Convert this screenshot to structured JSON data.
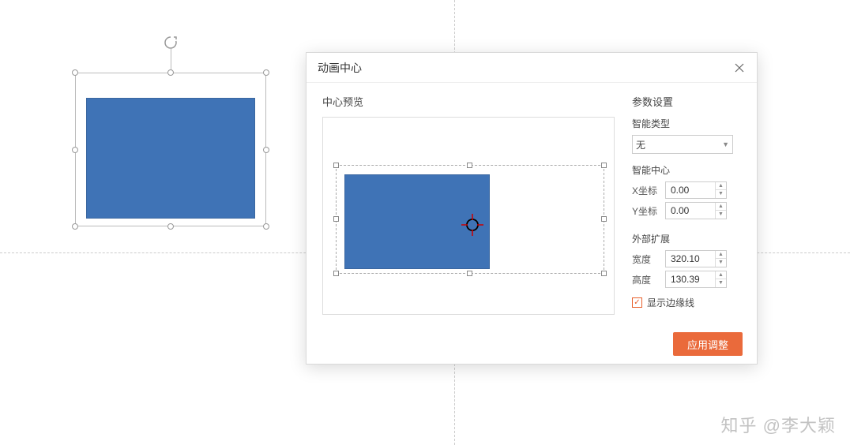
{
  "dialog": {
    "title": "动画中心",
    "preview_title": "中心预览",
    "params_title": "参数设置",
    "group_type_label": "智能类型",
    "type_value": "无",
    "group_center_label": "智能中心",
    "x_label": "X坐标",
    "x_value": "0.00",
    "y_label": "Y坐标",
    "y_value": "0.00",
    "group_extent_label": "外部扩展",
    "w_label": "宽度",
    "w_value": "320.10",
    "h_label": "高度",
    "h_value": "130.39",
    "show_edge_label": "显示边缘线",
    "apply_label": "应用调整"
  },
  "watermark": "知乎 @李大颖"
}
